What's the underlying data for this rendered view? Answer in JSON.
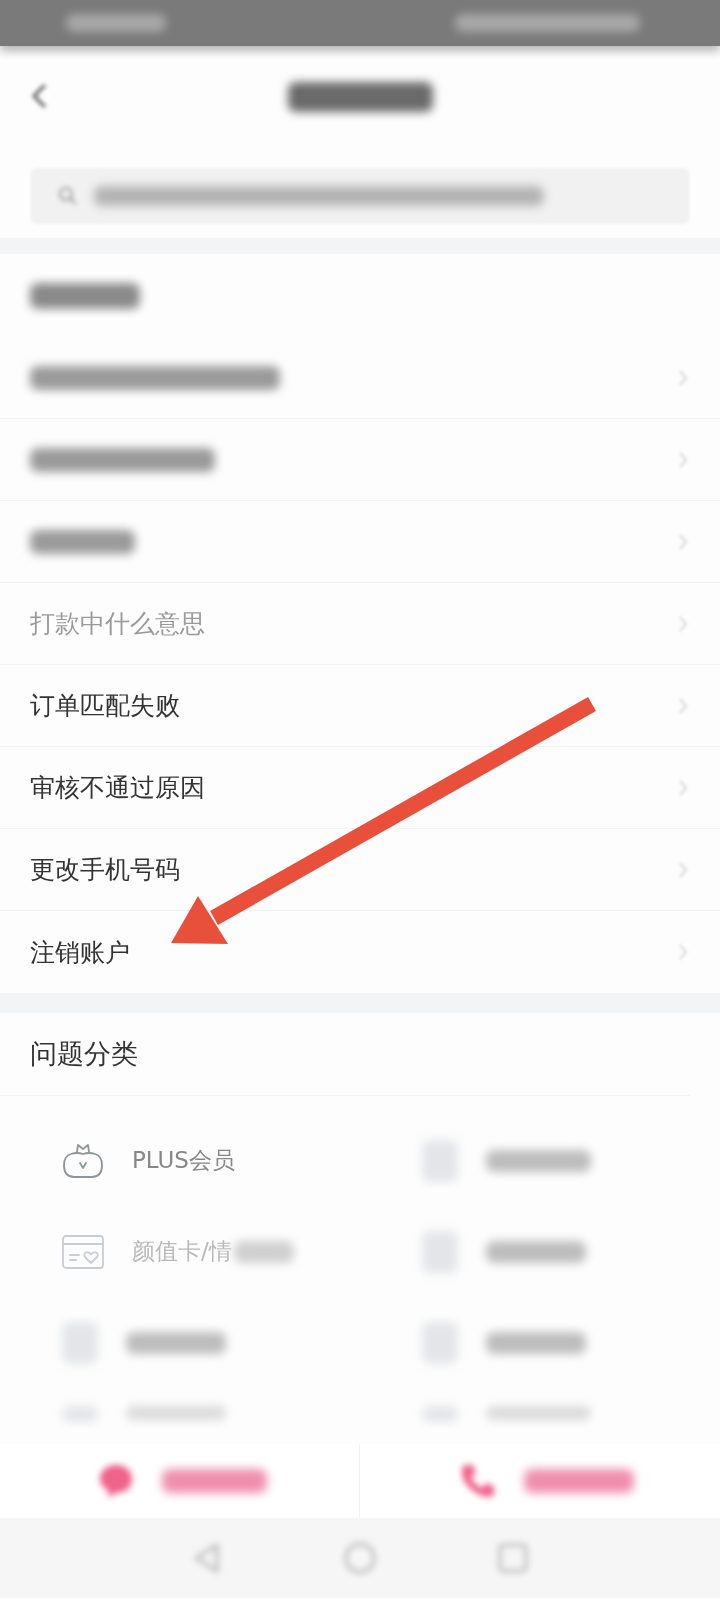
{
  "status_bar": {
    "items": [
      {
        "kind": "blurred"
      },
      {
        "kind": "blurred"
      }
    ]
  },
  "header": {
    "title": {
      "kind": "blurred"
    }
  },
  "search": {
    "placeholder": {
      "kind": "blurred"
    }
  },
  "faq": {
    "heading": {
      "kind": "blurred"
    },
    "items": [
      {
        "kind": "blurred"
      },
      {
        "kind": "blurred"
      },
      {
        "kind": "blurred"
      },
      {
        "kind": "text",
        "label": "打款中什么意思",
        "faded": true
      },
      {
        "kind": "text",
        "label": "订单匹配失败",
        "faded": false
      },
      {
        "kind": "text",
        "label": "审核不通过原因",
        "faded": false
      },
      {
        "kind": "text",
        "label": "更改手机号码",
        "faded": false
      },
      {
        "kind": "text",
        "label": "注销账户",
        "faded": false
      }
    ]
  },
  "categories": {
    "heading": "问题分类",
    "items": [
      {
        "kind": "text",
        "label": "PLUS会员",
        "faded": false
      },
      {
        "kind": "blurred"
      },
      {
        "kind": "partial",
        "label": "颜值卡/情",
        "faded": true
      },
      {
        "kind": "blurred"
      },
      {
        "kind": "blurred"
      },
      {
        "kind": "blurred"
      },
      {
        "kind": "blurred"
      },
      {
        "kind": "blurred"
      }
    ]
  },
  "bottom_actions": [
    {
      "kind": "blurred"
    },
    {
      "kind": "blurred"
    }
  ]
}
